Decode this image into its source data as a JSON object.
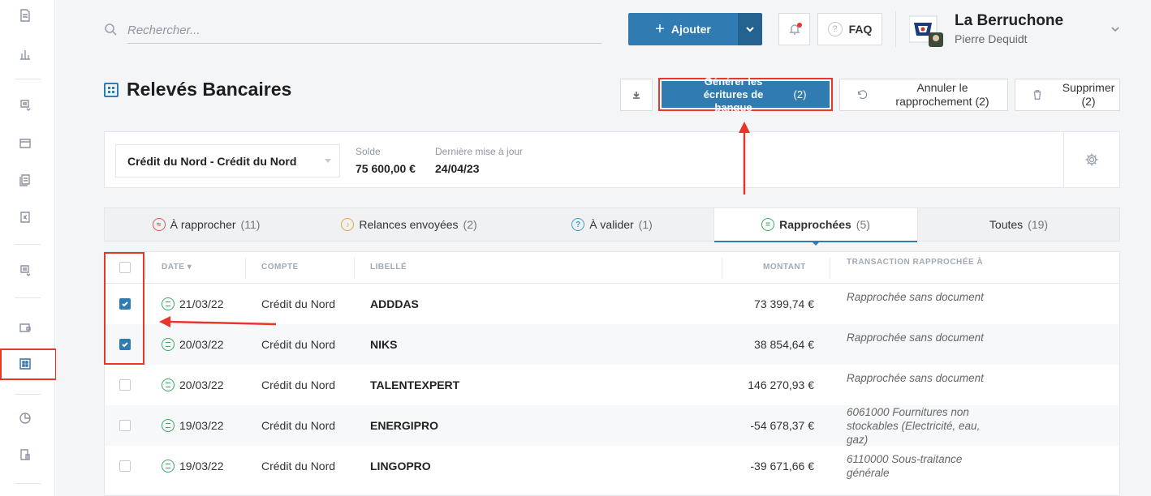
{
  "search": {
    "placeholder": "Rechercher..."
  },
  "header": {
    "add_label": "Ajouter",
    "faq_label": "FAQ",
    "faq_icon_text": "?",
    "company": "La Berruchone",
    "user": "Pierre Dequidt"
  },
  "page": {
    "title": "Relevés Bancaires"
  },
  "actions": {
    "generate_label": "Générer les écritures de banque",
    "generate_count": "(2)",
    "cancel_label": "Annuler le rapprochement (2)",
    "delete_label": "Supprimer (2)"
  },
  "account": {
    "selected": "Crédit du Nord - Crédit du Nord",
    "balance_label": "Solde",
    "balance_value": "75 600,00 €",
    "updated_label": "Dernière mise à jour",
    "updated_value": "24/04/23"
  },
  "tabs": [
    {
      "label": "À rapprocher",
      "count": "(11)",
      "icon": "≈",
      "color": "#e0505a"
    },
    {
      "label": "Relances envoyées",
      "count": "(2)",
      "icon": "bell",
      "color": "#e8a23a"
    },
    {
      "label": "À valider",
      "count": "(1)",
      "icon": "?",
      "color": "#3aa0d8"
    },
    {
      "label": "Rapprochées",
      "count": "(5)",
      "icon": "=",
      "color": "#39a862",
      "active": true
    },
    {
      "label": "Toutes",
      "count": "(19)"
    }
  ],
  "table": {
    "columns": [
      "DATE",
      "COMPTE",
      "LIBELLÉ",
      "MONTANT",
      "TRANSACTION RAPPROCHÉE À"
    ],
    "rows": [
      {
        "checked": true,
        "date": "21/03/22",
        "account": "Crédit du Nord",
        "label": "ADDDAS",
        "amount": "73 399,74 €",
        "transaction": "Rapprochée sans document"
      },
      {
        "checked": true,
        "date": "20/03/22",
        "account": "Crédit du Nord",
        "label": "NIKS",
        "amount": "38 854,64 €",
        "transaction": "Rapprochée sans document"
      },
      {
        "checked": false,
        "date": "20/03/22",
        "account": "Crédit du Nord",
        "label": "TALENTEXPERT",
        "amount": "146 270,93 €",
        "transaction": "Rapprochée sans document"
      },
      {
        "checked": false,
        "date": "19/03/22",
        "account": "Crédit du Nord",
        "label": "ENERGIPRO",
        "amount": "-54 678,37 €",
        "transaction": "6061000 Fournitures non stockables (Electricité, eau, gaz)"
      },
      {
        "checked": false,
        "date": "19/03/22",
        "account": "Crédit du Nord",
        "label": "LINGOPRO",
        "amount": "-39 671,66 €",
        "transaction": "6110000 Sous-traitance générale"
      }
    ]
  },
  "colors": {
    "accent": "#2f7bb2",
    "annotation": "#e8372a",
    "success": "#39a862"
  }
}
